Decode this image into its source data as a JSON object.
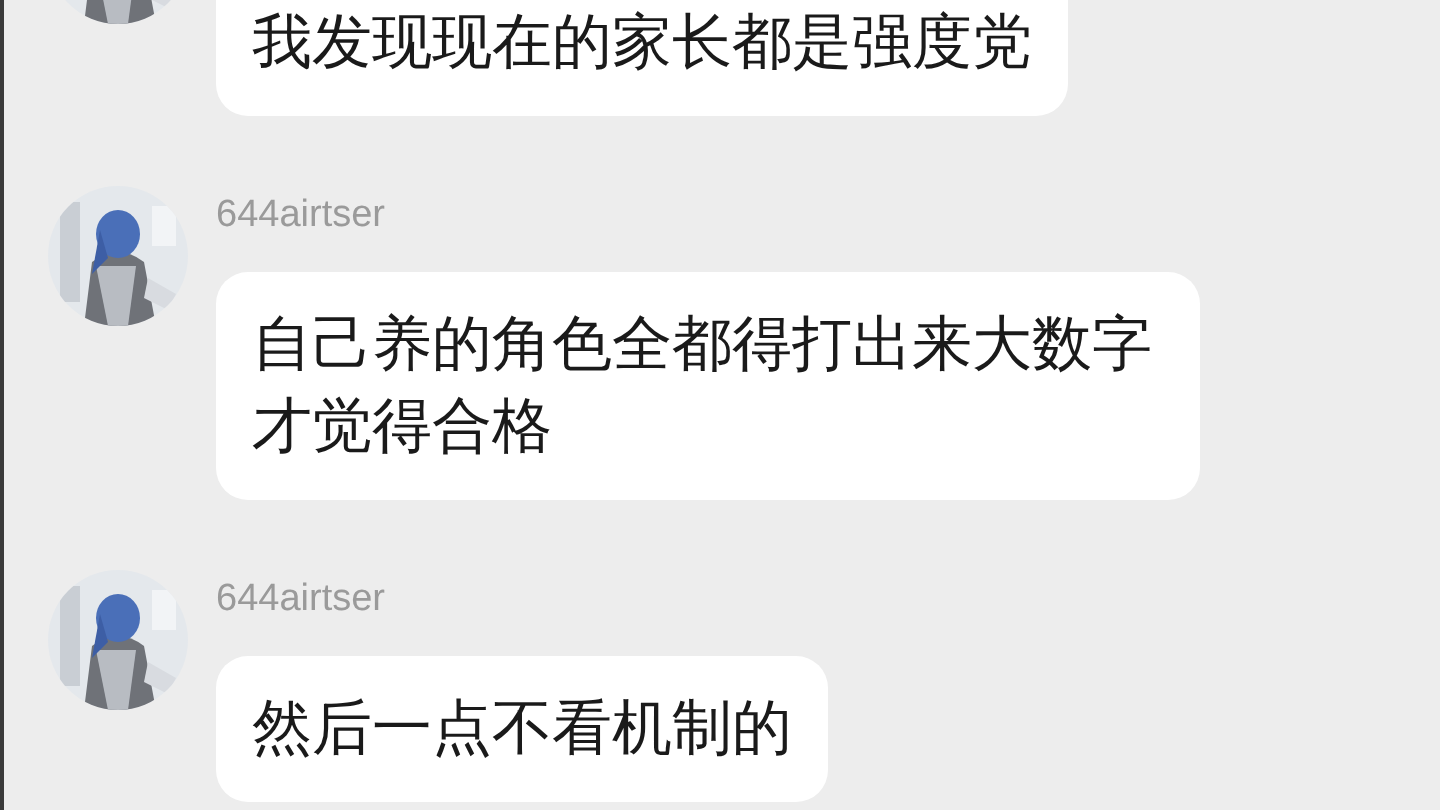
{
  "messages": [
    {
      "text": "我发现现在的家长都是强度党"
    },
    {
      "author": "644airtser",
      "text": "自己养的角色全都得打出来大数字才觉得合格"
    },
    {
      "author": "644airtser",
      "text": "然后一点不看机制的"
    }
  ]
}
